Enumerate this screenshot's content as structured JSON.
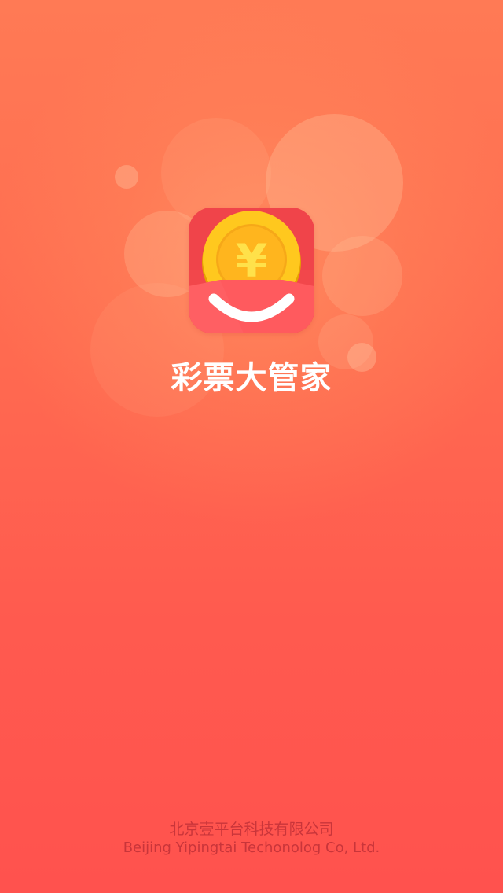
{
  "app": {
    "title": "彩票大管家",
    "icon_name": "lottery-coin-smile-icon",
    "currency_glyph": "¥"
  },
  "footer": {
    "company_cn": "北京壹平台科技有限公司",
    "company_en": "Beijing Yipingtai Techonolog Co, Ltd."
  },
  "colors": {
    "background_top": "#ff7a55",
    "background_bottom": "#ff524e",
    "icon_red": "#f24a4a",
    "coin_gold": "#ffc81e",
    "footer_text": "#c9353a"
  }
}
